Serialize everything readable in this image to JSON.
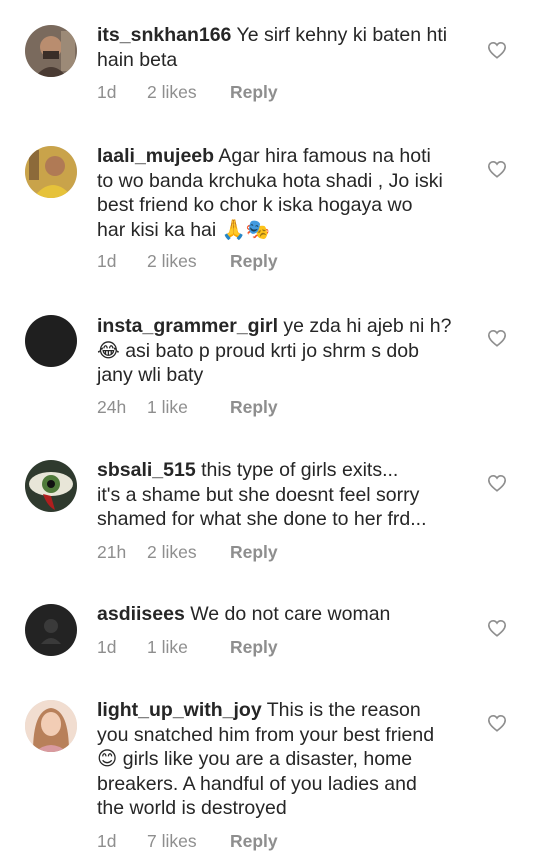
{
  "comments": [
    {
      "username": "its_snkhan166",
      "text": " Ye sirf kehny ki baten hti\nhain beta",
      "time": "1d",
      "likes": "2 likes",
      "reply": "Reply",
      "avatar_color": "#6b5a4e"
    },
    {
      "username": "laali_mujeeb",
      "text": " Agar hira famous na hoti\nto wo banda krchuka hota shadi , Jo iski\nbest friend ko chor k iska hogaya wo\nhar kisi ka hai 🙏🎭",
      "time": "1d",
      "likes": "2 likes",
      "reply": "Reply",
      "avatar_color": "#e3b24a"
    },
    {
      "username": "insta_grammer_girl",
      "text": " ye zda hi ajeb ni h?\n😂 asi bato p proud krti jo shrm s dob\njany wli baty",
      "time": "24h",
      "likes": "1 like",
      "reply": "Reply",
      "avatar_color": "#1f1f1f"
    },
    {
      "username": "sbsali_515",
      "text": " this type of girls exits...\nit's a shame but she doesnt feel sorry\nshamed for what she done to her frd...",
      "time": "21h",
      "likes": "2 likes",
      "reply": "Reply",
      "avatar_color": "#3d4a3c"
    },
    {
      "username": "asdiisees",
      "text": " We do not care woman",
      "time": "1d",
      "likes": "1 like",
      "reply": "Reply",
      "avatar_color": "#232323"
    },
    {
      "username": "light_up_with_joy",
      "text": " This is the reason\nyou snatched him from your best friend\n😊 girls like you are a disaster, home\nbreakers. A handful of you ladies and\nthe world is destroyed",
      "time": "1d",
      "likes": "7 likes",
      "reply": "Reply",
      "avatar_color": "#e9c1a8"
    }
  ],
  "icons": {
    "like": "heart-outline-icon"
  },
  "colors": {
    "text": "#262626",
    "meta": "#8e8e8e",
    "background": "#ffffff"
  }
}
